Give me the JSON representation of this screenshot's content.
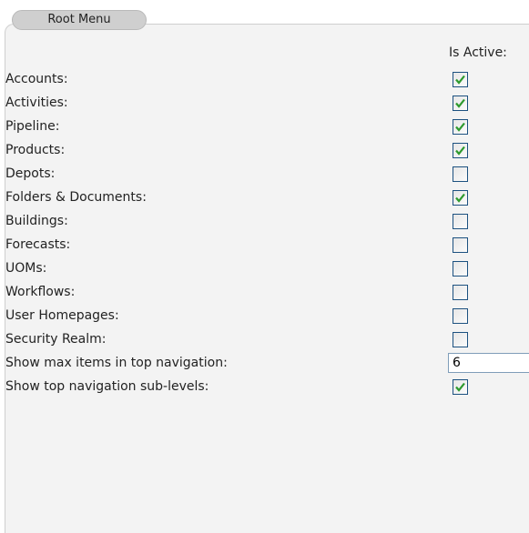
{
  "tab": {
    "label": "Root Menu"
  },
  "column_header": "Is Active:",
  "rows": [
    {
      "label": "Accounts:",
      "checked": true
    },
    {
      "label": "Activities:",
      "checked": true
    },
    {
      "label": "Pipeline:",
      "checked": true
    },
    {
      "label": "Products:",
      "checked": true
    },
    {
      "label": "Depots:",
      "checked": false
    },
    {
      "label": "Folders & Documents:",
      "checked": true
    },
    {
      "label": "Buildings:",
      "checked": false
    },
    {
      "label": "Forecasts:",
      "checked": false
    },
    {
      "label": "UOMs:",
      "checked": false
    },
    {
      "label": "Workflows:",
      "checked": false
    },
    {
      "label": "User Homepages:",
      "checked": false
    },
    {
      "label": "Security Realm:",
      "checked": false
    }
  ],
  "max_items": {
    "label": "Show max items in top navigation:",
    "value": "6"
  },
  "sub_levels": {
    "label": "Show top navigation sub-levels:",
    "checked": true
  },
  "colors": {
    "check": "#2e9a2e",
    "checkbox_border": "#1c5180"
  }
}
